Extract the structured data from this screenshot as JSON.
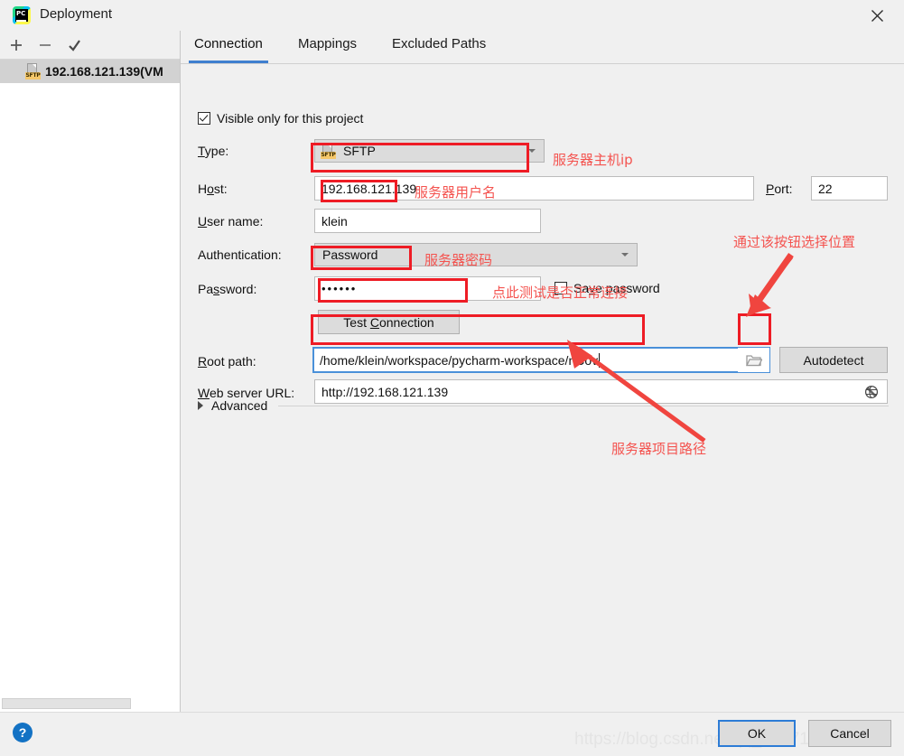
{
  "window": {
    "title": "Deployment",
    "logo_text": "PC",
    "close_label": "✕"
  },
  "sidebar": {
    "toolbar": {
      "add_label": "+",
      "remove_label": "−",
      "check_label": "✓"
    },
    "items": [
      {
        "label": "192.168.121.139(VM",
        "icon": "sftp-icon",
        "icon_text": "SFTP",
        "selected": true
      }
    ]
  },
  "tabs": [
    {
      "label": "Connection",
      "active": true
    },
    {
      "label": "Mappings",
      "active": false
    },
    {
      "label": "Excluded Paths",
      "active": false
    }
  ],
  "form": {
    "visible_only": {
      "label": "Visible only for this project",
      "checked": true
    },
    "type": {
      "label": "Type:",
      "value": "SFTP",
      "icon_text": "SFTP"
    },
    "host": {
      "label": "Host:",
      "value": "192.168.121.139"
    },
    "port": {
      "label": "Port:",
      "value": "22"
    },
    "username": {
      "label": "User name:",
      "value": "klein"
    },
    "authentication": {
      "label": "Authentication:",
      "value": "Password"
    },
    "password": {
      "label": "Password:",
      "value": "••••••"
    },
    "save_password": {
      "label": "Save password",
      "checked": false
    },
    "test_connection": {
      "label": "Test Connection"
    },
    "root_path": {
      "label": "Root path:",
      "value": "/home/klein/workspace/pycharm-workspace/nCov",
      "focused": true
    },
    "browse_button": {
      "icon": "folder-icon"
    },
    "autodetect": {
      "label": "Autodetect"
    },
    "web_server_url": {
      "label": "Web server URL:",
      "value": "http://192.168.121.139",
      "icon": "globe-icon"
    },
    "advanced": {
      "label": "Advanced"
    }
  },
  "annotations": [
    {
      "id": "host-note",
      "text": "服务器主机ip"
    },
    {
      "id": "username-note",
      "text": "服务器用户名"
    },
    {
      "id": "password-note",
      "text": "服务器密码"
    },
    {
      "id": "test-note",
      "text": "点此测试是否正常连接"
    },
    {
      "id": "browse-note",
      "text": "通过该按钮选择位置"
    },
    {
      "id": "rootpath-note",
      "text": "服务器项目路径"
    }
  ],
  "footer": {
    "help_label": "?",
    "ok_label": "OK",
    "cancel_label": "Cancel",
    "watermark": "https://blog.csdn.net/qq_41971763"
  },
  "colors": {
    "accent": "#3f7fcf",
    "annotation_red": "#f4534f",
    "box_red": "#ee1c25",
    "help_blue": "#1372c4"
  }
}
